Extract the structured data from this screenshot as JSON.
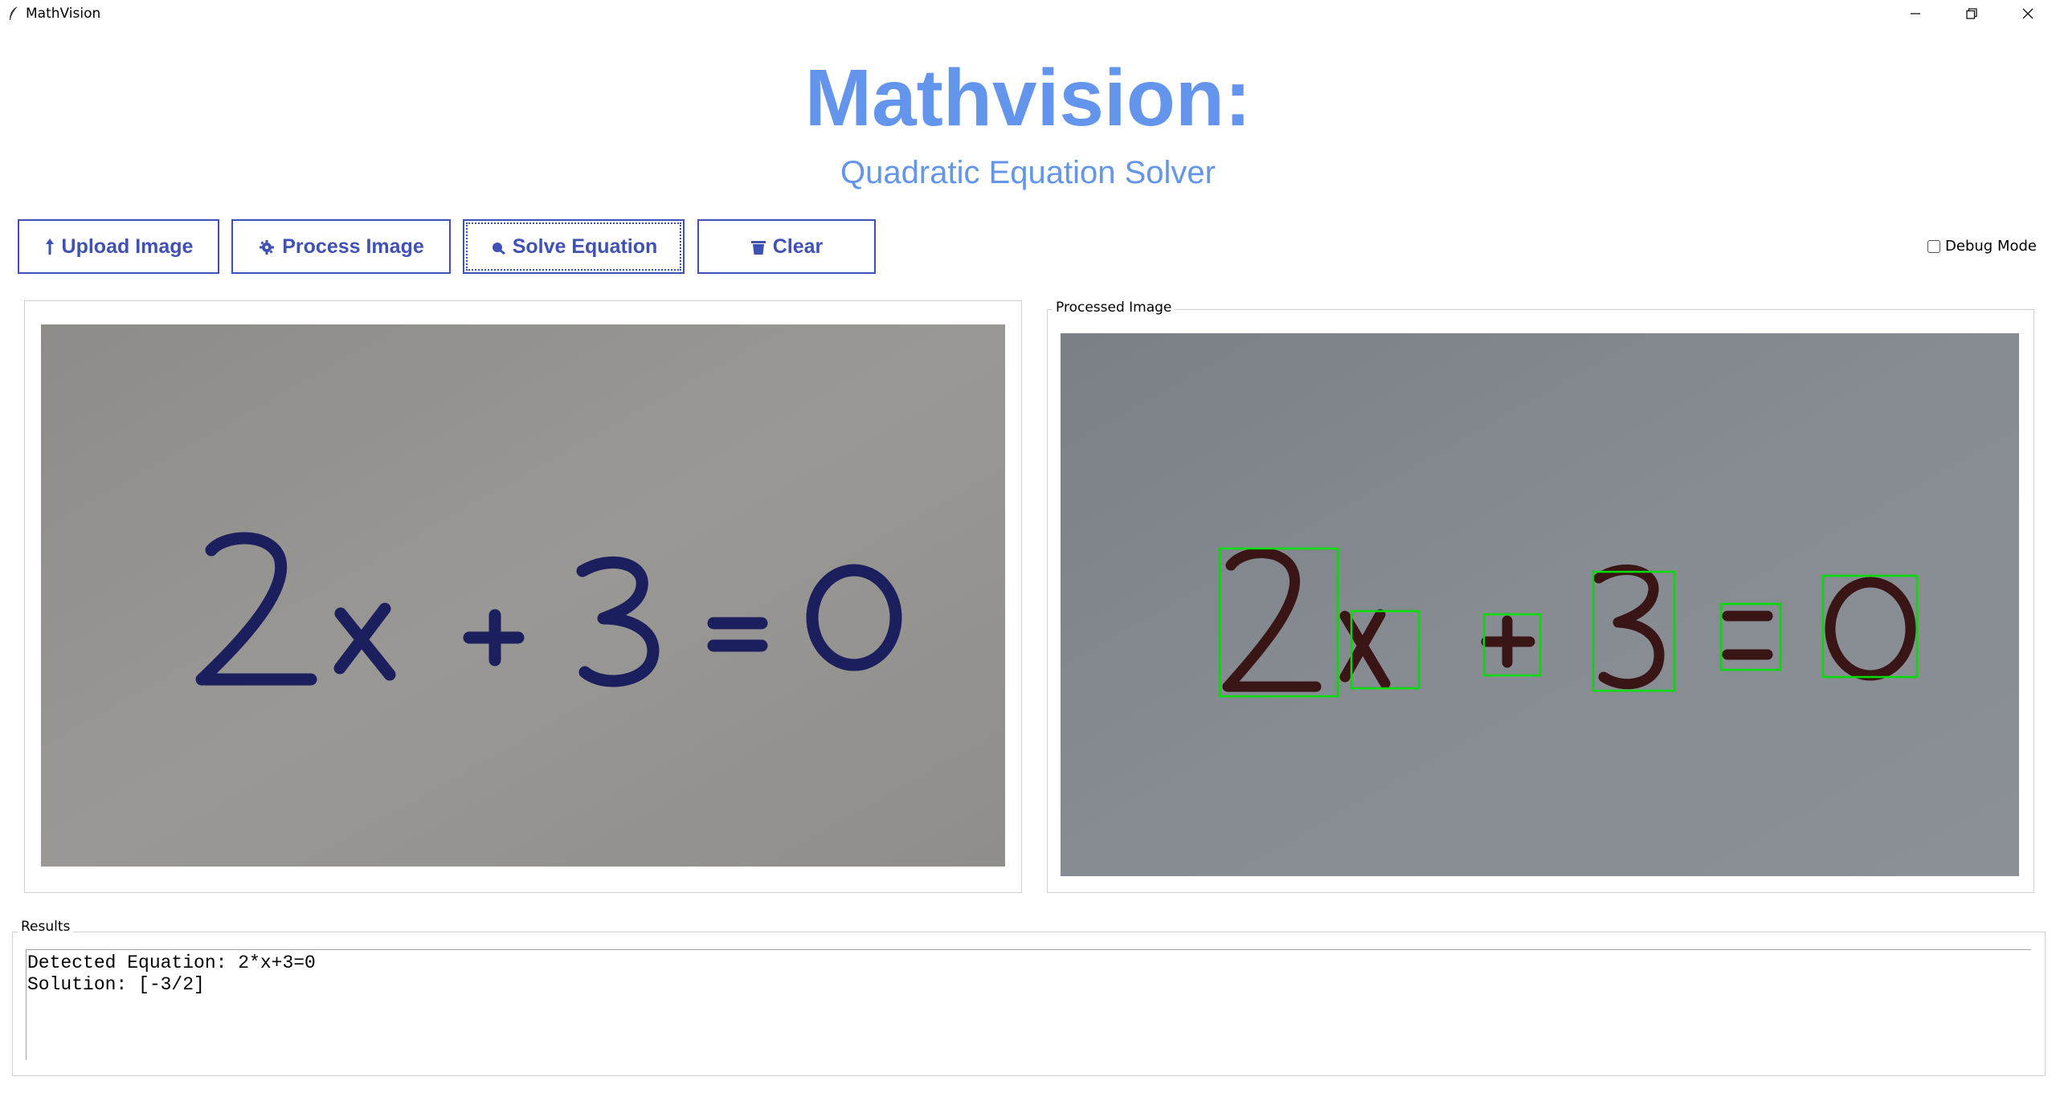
{
  "window": {
    "title": "MathVision"
  },
  "header": {
    "title": "Mathvision:",
    "subtitle": "Quadratic Equation Solver",
    "accent_color": "#6495ed"
  },
  "toolbar": {
    "buttons": [
      {
        "label": "Upload Image",
        "icon": "upload-arrow-icon"
      },
      {
        "label": "Process Image",
        "icon": "gear-icon"
      },
      {
        "label": "Solve Equation",
        "icon": "magnifier-icon"
      },
      {
        "label": "Clear",
        "icon": "trash-icon"
      }
    ],
    "button_color": "#3f51b5",
    "debug_label": "Debug Mode",
    "debug_checked": false
  },
  "panels": {
    "original": {
      "label": "",
      "image_content": "2x+3=0"
    },
    "processed": {
      "label": "Processed Image",
      "image_content": "2x+3=0",
      "box_color": "#00dd00"
    }
  },
  "results": {
    "label": "Results",
    "line1": "Detected Equation: 2*x+3=0",
    "line2": "Solution: [-3/2]"
  }
}
